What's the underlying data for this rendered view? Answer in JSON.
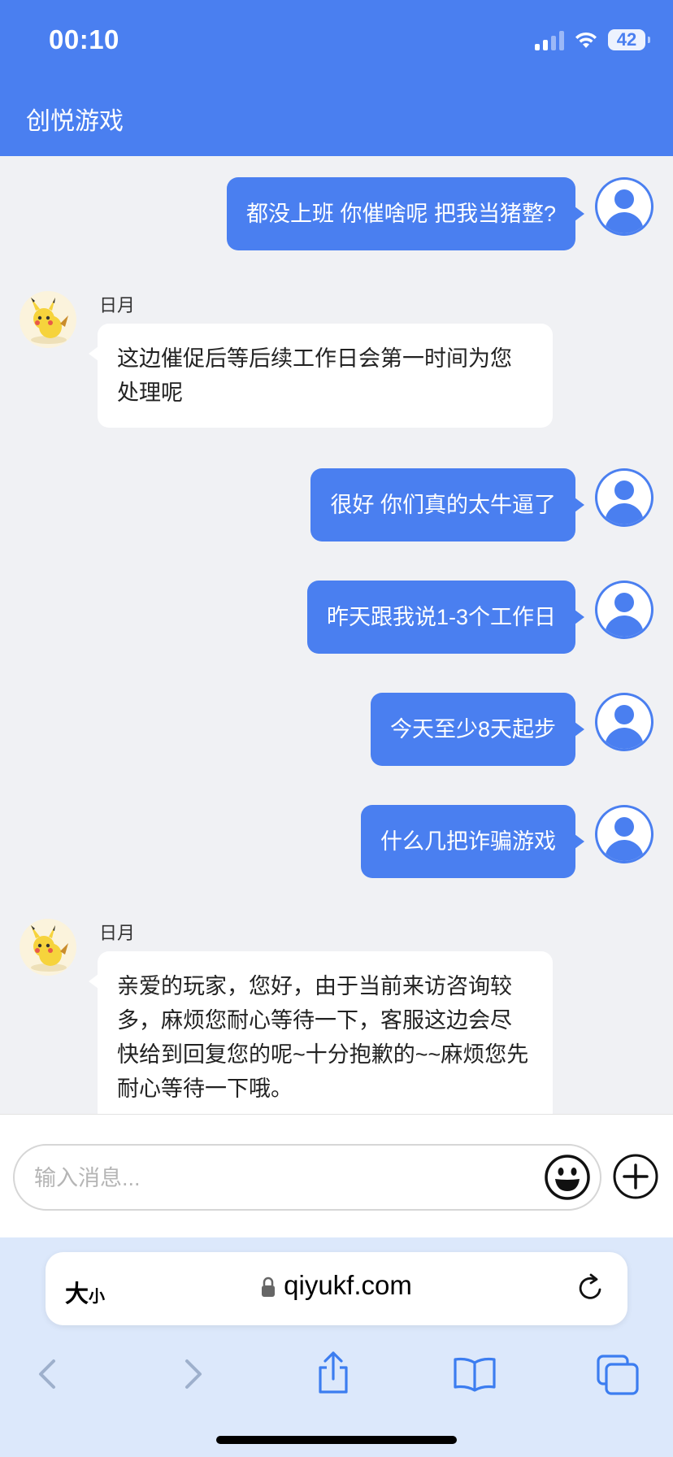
{
  "status_bar": {
    "time": "00:10",
    "battery": "42"
  },
  "app": {
    "title": "创悦游戏"
  },
  "messages": {
    "m1": {
      "text": "都没上班 你催啥呢 把我当猪整?"
    },
    "m2": {
      "sender": "日月",
      "text": "这边催促后等后续工作日会第一时间为您处理呢"
    },
    "m3": {
      "text": "很好 你们真的太牛逼了"
    },
    "m4": {
      "text": "昨天跟我说1-3个工作日"
    },
    "m5": {
      "text": "今天至少8天起步"
    },
    "m6": {
      "text": "什么几把诈骗游戏"
    },
    "m7": {
      "sender": "日月",
      "text": "亲爱的玩家，您好，由于当前来访咨询较多，麻烦您耐心等待一下，客服这边会尽快给到回复您的呢~十分抱歉的~~麻烦您先耐心等待一下哦。"
    }
  },
  "composer": {
    "placeholder": "输入消息..."
  },
  "browser": {
    "text_size_large": "大",
    "text_size_small": "小",
    "url": "qiyukf.com"
  },
  "colors": {
    "accent": "#4a7ff0",
    "chat_bg": "#f0f1f4",
    "browser_bg": "#dce8fb"
  },
  "icons": [
    "signal-icon",
    "wifi-icon",
    "battery-icon",
    "user-avatar-icon",
    "agent-avatar-pikachu",
    "emoji-icon",
    "plus-icon",
    "lock-icon",
    "reload-icon",
    "back-icon",
    "forward-icon",
    "share-icon",
    "bookmarks-icon",
    "tabs-icon"
  ]
}
